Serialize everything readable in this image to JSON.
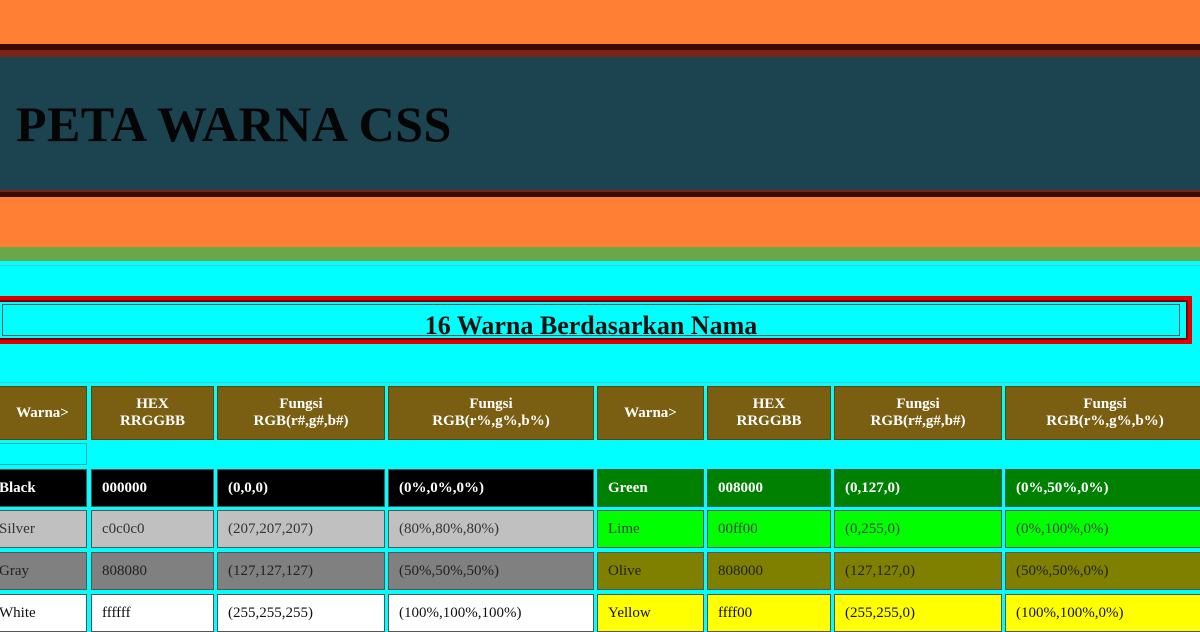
{
  "header": {
    "title": "PETA WARNA CSS"
  },
  "section": {
    "title": "16 Warna Berdasarkan Nama"
  },
  "table": {
    "headers": [
      "Warna>",
      "HEX\nRRGGBB",
      "Fungsi\nRGB(r#,g#,b#)",
      "Fungsi\nRGB(r%,g%,b%)",
      "Warna>",
      "HEX\nRRGGBB",
      "Fungsi\nRGB(r#,g#,b#)",
      "Fungsi\nRGB(r%,g%,b%)"
    ],
    "rows": [
      {
        "left": {
          "name": "Black",
          "hex": "000000",
          "rgb": "(0,0,0)",
          "pct": "(0%,0%,0%)",
          "bg": "#000000",
          "fg": "#ffffff",
          "bold": true
        },
        "right": {
          "name": "Green",
          "hex": "008000",
          "rgb": "(0,127,0)",
          "pct": "(0%,50%,0%)",
          "bg": "#008000",
          "fg": "#ffffff",
          "bold": true
        }
      },
      {
        "left": {
          "name": "Silver",
          "hex": "c0c0c0",
          "rgb": "(207,207,207)",
          "pct": "(80%,80%,80%)",
          "bg": "#c0c0c0",
          "fg": "#333333",
          "bold": false
        },
        "right": {
          "name": "Lime",
          "hex": "00ff00",
          "rgb": "(0,255,0)",
          "pct": "(0%,100%,0%)",
          "bg": "#00ff00",
          "fg": "#444444",
          "bold": false
        }
      },
      {
        "left": {
          "name": "Gray",
          "hex": "808080",
          "rgb": "(127,127,127)",
          "pct": "(50%,50%,50%)",
          "bg": "#808080",
          "fg": "#222222",
          "bold": false
        },
        "right": {
          "name": "Olive",
          "hex": "808000",
          "rgb": "(127,127,0)",
          "pct": "(50%,50%,0%)",
          "bg": "#808000",
          "fg": "#222222",
          "bold": false
        }
      },
      {
        "left": {
          "name": "White",
          "hex": "ffffff",
          "rgb": "(255,255,255)",
          "pct": "(100%,100%,100%)",
          "bg": "#ffffff",
          "fg": "#111111",
          "bold": false
        },
        "right": {
          "name": "Yellow",
          "hex": "ffff00",
          "rgb": "(255,255,0)",
          "pct": "(100%,100%,0%)",
          "bg": "#ffff00",
          "fg": "#111111",
          "bold": false
        }
      }
    ]
  },
  "colors": {
    "orange_band": "#ff8035",
    "header_panel": "#1b4350",
    "green_band": "#68a848",
    "page_background": "#00ffff",
    "section_border": "#e00000",
    "table_header": "#7a5e12"
  }
}
